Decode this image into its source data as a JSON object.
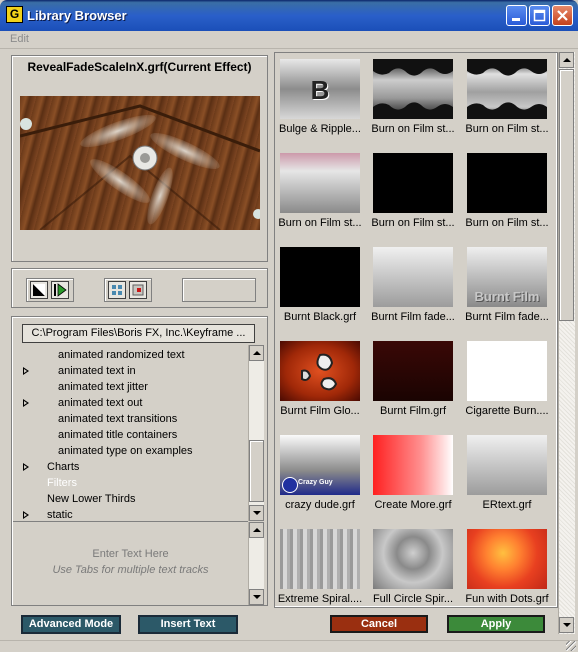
{
  "window": {
    "title": "Library Browser",
    "app_icon": "G"
  },
  "menu": {
    "items": [
      "Edit"
    ]
  },
  "preview": {
    "title": "RevealFadeScaleInX.grf(Current Effect)"
  },
  "tree": {
    "path": "C:\\Program Files\\Boris FX, Inc.\\Keyframe ...",
    "items": [
      {
        "label": "animated randomized text",
        "expandable": false,
        "indent": 1
      },
      {
        "label": "animated text in",
        "expandable": true,
        "indent": 1
      },
      {
        "label": "animated text jitter",
        "expandable": false,
        "indent": 1
      },
      {
        "label": "animated text out",
        "expandable": true,
        "indent": 1
      },
      {
        "label": "animated text transitions",
        "expandable": false,
        "indent": 1
      },
      {
        "label": "animated title containers",
        "expandable": false,
        "indent": 1
      },
      {
        "label": "animated type on examples",
        "expandable": false,
        "indent": 1
      },
      {
        "label": "Charts",
        "expandable": true,
        "indent": 0
      },
      {
        "label": "Filters",
        "expandable": false,
        "indent": 0,
        "selected": true
      },
      {
        "label": "New Lower Thirds",
        "expandable": false,
        "indent": 0
      },
      {
        "label": "static",
        "expandable": true,
        "indent": 0
      }
    ]
  },
  "text_entry": {
    "line1": "Enter Text Here",
    "line2": "Use Tabs for multiple text tracks"
  },
  "buttons": {
    "advanced_mode": "Advanced Mode",
    "insert_text": "Insert Text",
    "cancel": "Cancel",
    "apply": "Apply"
  },
  "library": {
    "items": [
      {
        "label": "Bulge & Ripple...",
        "style": "bulge",
        "overlay": "B"
      },
      {
        "label": "Burn on Film st...",
        "style": "burn1"
      },
      {
        "label": "Burn on Film st...",
        "style": "burn2"
      },
      {
        "label": "Burn on Film st...",
        "style": "burn3"
      },
      {
        "label": "Burn on Film st...",
        "style": "black"
      },
      {
        "label": "Burn on Film st...",
        "style": "black"
      },
      {
        "label": "Burnt Black.grf",
        "style": "black"
      },
      {
        "label": "Burnt Film fade...",
        "style": "grey"
      },
      {
        "label": "Burnt Film fade...",
        "style": "burntfilm",
        "overlay": "Burnt Film"
      },
      {
        "label": "Burnt Film Glo...",
        "style": "glow"
      },
      {
        "label": "Burnt Film.grf",
        "style": "darkred"
      },
      {
        "label": "Cigarette Burn....",
        "style": "white"
      },
      {
        "label": "crazy dude.grf",
        "style": "crazy",
        "overlay": "Crazy Guy"
      },
      {
        "label": "Create More.grf",
        "style": "create"
      },
      {
        "label": "ERtext.grf",
        "style": "grey"
      },
      {
        "label": "Extreme Spiral....",
        "style": "spiral"
      },
      {
        "label": "Full Circle Spir...",
        "style": "circle"
      },
      {
        "label": "Fun with Dots.grf",
        "style": "dots"
      }
    ]
  }
}
